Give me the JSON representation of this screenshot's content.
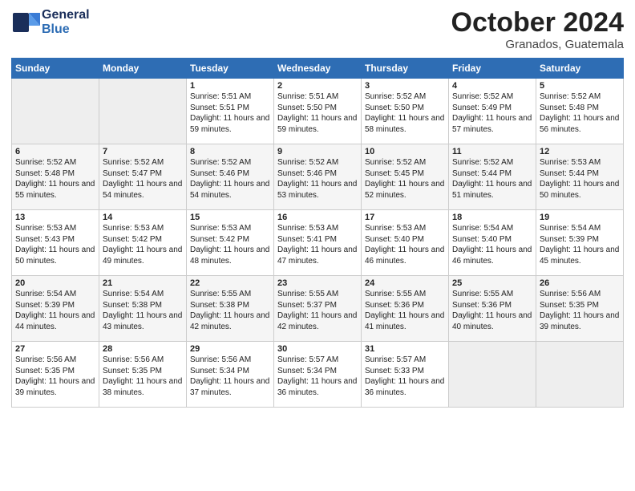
{
  "header": {
    "logo_general": "General",
    "logo_blue": "Blue",
    "month": "October 2024",
    "location": "Granados, Guatemala"
  },
  "weekdays": [
    "Sunday",
    "Monday",
    "Tuesday",
    "Wednesday",
    "Thursday",
    "Friday",
    "Saturday"
  ],
  "weeks": [
    [
      {
        "day": "",
        "sunrise": "",
        "sunset": "",
        "daylight": ""
      },
      {
        "day": "",
        "sunrise": "",
        "sunset": "",
        "daylight": ""
      },
      {
        "day": "1",
        "sunrise": "Sunrise: 5:51 AM",
        "sunset": "Sunset: 5:51 PM",
        "daylight": "Daylight: 11 hours and 59 minutes."
      },
      {
        "day": "2",
        "sunrise": "Sunrise: 5:51 AM",
        "sunset": "Sunset: 5:50 PM",
        "daylight": "Daylight: 11 hours and 59 minutes."
      },
      {
        "day": "3",
        "sunrise": "Sunrise: 5:52 AM",
        "sunset": "Sunset: 5:50 PM",
        "daylight": "Daylight: 11 hours and 58 minutes."
      },
      {
        "day": "4",
        "sunrise": "Sunrise: 5:52 AM",
        "sunset": "Sunset: 5:49 PM",
        "daylight": "Daylight: 11 hours and 57 minutes."
      },
      {
        "day": "5",
        "sunrise": "Sunrise: 5:52 AM",
        "sunset": "Sunset: 5:48 PM",
        "daylight": "Daylight: 11 hours and 56 minutes."
      }
    ],
    [
      {
        "day": "6",
        "sunrise": "Sunrise: 5:52 AM",
        "sunset": "Sunset: 5:48 PM",
        "daylight": "Daylight: 11 hours and 55 minutes."
      },
      {
        "day": "7",
        "sunrise": "Sunrise: 5:52 AM",
        "sunset": "Sunset: 5:47 PM",
        "daylight": "Daylight: 11 hours and 54 minutes."
      },
      {
        "day": "8",
        "sunrise": "Sunrise: 5:52 AM",
        "sunset": "Sunset: 5:46 PM",
        "daylight": "Daylight: 11 hours and 54 minutes."
      },
      {
        "day": "9",
        "sunrise": "Sunrise: 5:52 AM",
        "sunset": "Sunset: 5:46 PM",
        "daylight": "Daylight: 11 hours and 53 minutes."
      },
      {
        "day": "10",
        "sunrise": "Sunrise: 5:52 AM",
        "sunset": "Sunset: 5:45 PM",
        "daylight": "Daylight: 11 hours and 52 minutes."
      },
      {
        "day": "11",
        "sunrise": "Sunrise: 5:52 AM",
        "sunset": "Sunset: 5:44 PM",
        "daylight": "Daylight: 11 hours and 51 minutes."
      },
      {
        "day": "12",
        "sunrise": "Sunrise: 5:53 AM",
        "sunset": "Sunset: 5:44 PM",
        "daylight": "Daylight: 11 hours and 50 minutes."
      }
    ],
    [
      {
        "day": "13",
        "sunrise": "Sunrise: 5:53 AM",
        "sunset": "Sunset: 5:43 PM",
        "daylight": "Daylight: 11 hours and 50 minutes."
      },
      {
        "day": "14",
        "sunrise": "Sunrise: 5:53 AM",
        "sunset": "Sunset: 5:42 PM",
        "daylight": "Daylight: 11 hours and 49 minutes."
      },
      {
        "day": "15",
        "sunrise": "Sunrise: 5:53 AM",
        "sunset": "Sunset: 5:42 PM",
        "daylight": "Daylight: 11 hours and 48 minutes."
      },
      {
        "day": "16",
        "sunrise": "Sunrise: 5:53 AM",
        "sunset": "Sunset: 5:41 PM",
        "daylight": "Daylight: 11 hours and 47 minutes."
      },
      {
        "day": "17",
        "sunrise": "Sunrise: 5:53 AM",
        "sunset": "Sunset: 5:40 PM",
        "daylight": "Daylight: 11 hours and 46 minutes."
      },
      {
        "day": "18",
        "sunrise": "Sunrise: 5:54 AM",
        "sunset": "Sunset: 5:40 PM",
        "daylight": "Daylight: 11 hours and 46 minutes."
      },
      {
        "day": "19",
        "sunrise": "Sunrise: 5:54 AM",
        "sunset": "Sunset: 5:39 PM",
        "daylight": "Daylight: 11 hours and 45 minutes."
      }
    ],
    [
      {
        "day": "20",
        "sunrise": "Sunrise: 5:54 AM",
        "sunset": "Sunset: 5:39 PM",
        "daylight": "Daylight: 11 hours and 44 minutes."
      },
      {
        "day": "21",
        "sunrise": "Sunrise: 5:54 AM",
        "sunset": "Sunset: 5:38 PM",
        "daylight": "Daylight: 11 hours and 43 minutes."
      },
      {
        "day": "22",
        "sunrise": "Sunrise: 5:55 AM",
        "sunset": "Sunset: 5:38 PM",
        "daylight": "Daylight: 11 hours and 42 minutes."
      },
      {
        "day": "23",
        "sunrise": "Sunrise: 5:55 AM",
        "sunset": "Sunset: 5:37 PM",
        "daylight": "Daylight: 11 hours and 42 minutes."
      },
      {
        "day": "24",
        "sunrise": "Sunrise: 5:55 AM",
        "sunset": "Sunset: 5:36 PM",
        "daylight": "Daylight: 11 hours and 41 minutes."
      },
      {
        "day": "25",
        "sunrise": "Sunrise: 5:55 AM",
        "sunset": "Sunset: 5:36 PM",
        "daylight": "Daylight: 11 hours and 40 minutes."
      },
      {
        "day": "26",
        "sunrise": "Sunrise: 5:56 AM",
        "sunset": "Sunset: 5:35 PM",
        "daylight": "Daylight: 11 hours and 39 minutes."
      }
    ],
    [
      {
        "day": "27",
        "sunrise": "Sunrise: 5:56 AM",
        "sunset": "Sunset: 5:35 PM",
        "daylight": "Daylight: 11 hours and 39 minutes."
      },
      {
        "day": "28",
        "sunrise": "Sunrise: 5:56 AM",
        "sunset": "Sunset: 5:35 PM",
        "daylight": "Daylight: 11 hours and 38 minutes."
      },
      {
        "day": "29",
        "sunrise": "Sunrise: 5:56 AM",
        "sunset": "Sunset: 5:34 PM",
        "daylight": "Daylight: 11 hours and 37 minutes."
      },
      {
        "day": "30",
        "sunrise": "Sunrise: 5:57 AM",
        "sunset": "Sunset: 5:34 PM",
        "daylight": "Daylight: 11 hours and 36 minutes."
      },
      {
        "day": "31",
        "sunrise": "Sunrise: 5:57 AM",
        "sunset": "Sunset: 5:33 PM",
        "daylight": "Daylight: 11 hours and 36 minutes."
      },
      {
        "day": "",
        "sunrise": "",
        "sunset": "",
        "daylight": ""
      },
      {
        "day": "",
        "sunrise": "",
        "sunset": "",
        "daylight": ""
      }
    ]
  ]
}
